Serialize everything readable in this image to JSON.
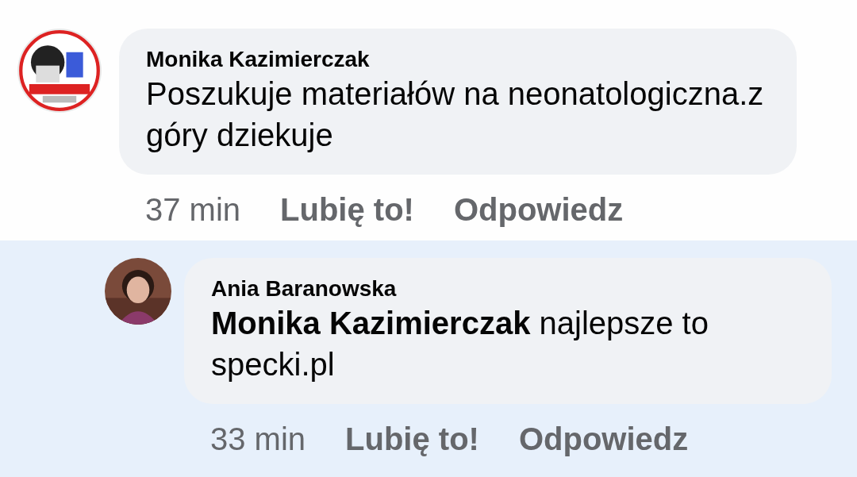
{
  "comments": [
    {
      "author": "Monika Kazimierczak",
      "text": "Poszukuje materiałów na neonatologiczna.z góry dziekuje",
      "time": "37 min",
      "like": "Lubię to!",
      "reply": "Odpowiedz",
      "highlighted": false,
      "children": [
        {
          "author": "Ania Baranowska",
          "text": "**Monika Kazimierczak** najlepsze to specki.pl",
          "time": "33 min",
          "like": "Lubię to!",
          "reply": "Odpowiedz",
          "highlighted": true
        }
      ]
    }
  ]
}
